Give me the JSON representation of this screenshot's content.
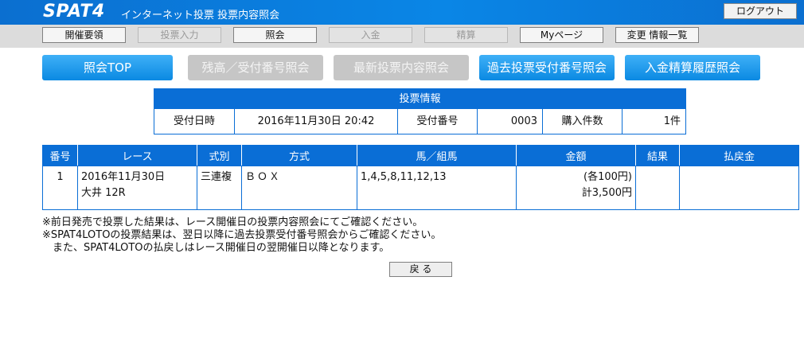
{
  "header": {
    "logo": "SPAT4",
    "title": "インターネット投票  投票内容照会",
    "logout": "ログアウト"
  },
  "nav": {
    "items": [
      {
        "label": "開催要領",
        "enabled": true
      },
      {
        "label": "投票入力",
        "enabled": false
      },
      {
        "label": "照会",
        "enabled": true
      },
      {
        "label": "入金",
        "enabled": false
      },
      {
        "label": "精算",
        "enabled": false
      },
      {
        "label": "Myページ",
        "enabled": true
      },
      {
        "label": "変更 情報一覧",
        "enabled": true
      }
    ]
  },
  "inquiry_buttons": [
    {
      "label": "照会TOP",
      "enabled": true
    },
    {
      "label": "残高／受付番号照会",
      "enabled": false
    },
    {
      "label": "最新投票内容照会",
      "enabled": false
    },
    {
      "label": "過去投票受付番号照会",
      "enabled": true
    },
    {
      "label": "入金精算履歴照会",
      "enabled": true
    }
  ],
  "ticket": {
    "heading": "投票情報",
    "received_label": "受付日時",
    "received_value": "2016年11月30日 20:42",
    "number_label": "受付番号",
    "number_value": "0003",
    "count_label": "購入件数",
    "count_value": "1件"
  },
  "bets": {
    "headers": [
      "番号",
      "レース",
      "式別",
      "方式",
      "馬／組馬",
      "金額",
      "結果",
      "払戻金"
    ],
    "rows": [
      {
        "no": "1",
        "race_date": "2016年11月30日",
        "race_name": "大井 12R",
        "type": "三連複",
        "method": "ＢＯＸ",
        "horses": "1,4,5,8,11,12,13",
        "amount_each": "(各100円)",
        "amount_total": "計3,500円",
        "result": "",
        "payout": ""
      }
    ]
  },
  "notes": [
    "※前日発売で投票した結果は、レース開催日の投票内容照会にてご確認ください。",
    "※SPAT4LOTOの投票結果は、翌日以降に過去投票受付番号照会からご確認ください。",
    "　また、SPAT4LOTOの払戻しはレース開催日の翌開催日以降となります。"
  ],
  "back_button": "戻 る",
  "colors": {
    "header_blue": "#0b6fd0",
    "table_blue": "#0a6ed6",
    "button_blue": "#1a9be9",
    "disabled_gray": "#c6c6c6"
  }
}
